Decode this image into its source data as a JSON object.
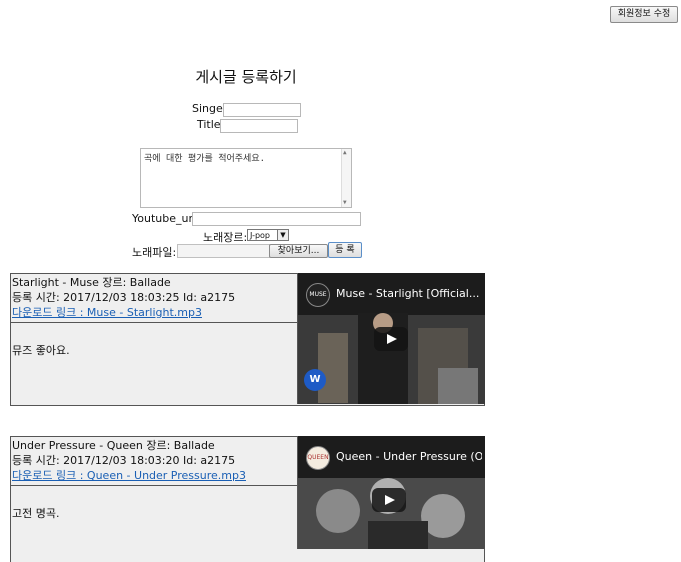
{
  "header": {
    "edit_profile_label": "회원정보 수정"
  },
  "form": {
    "title": "게시글 등록하기",
    "singer_label": "Singer",
    "title_label": "Title",
    "review_text": "곡에 대한 평가를 적어주세요.",
    "youtube_label": "Youtube_url",
    "genre_label": "노래장르:",
    "genre_selected": "J-pop",
    "file_label": "노래파일:",
    "browse_label": "찾아보기...",
    "submit_label": "등 록"
  },
  "posts": [
    {
      "header": "Starlight - Muse   장르: Ballade",
      "time": "등록 시간: 2017/12/03 18:03:25   Id: a2175",
      "download": "다운로드 링크 : Muse - Starlight.mp3",
      "comment": "뮤즈 좋아요.",
      "video_title": "Muse - Starlight [Official...",
      "channel_logo": "MUSE",
      "publisher_logo": "W"
    },
    {
      "header": "Under Pressure - Queen   장르: Ballade",
      "time": "등록 시간: 2017/12/03 18:03:20   Id: a2175",
      "download": "다운로드 링크 : Queen - Under Pressure.mp3",
      "comment": "고전 명곡.",
      "video_title": "Queen - Under Pressure (O...",
      "channel_logo": "QUEEN"
    }
  ],
  "colors": {
    "link": "#1a5fb4",
    "panel": "#efefef",
    "video_bg": "#2b2b2b"
  }
}
